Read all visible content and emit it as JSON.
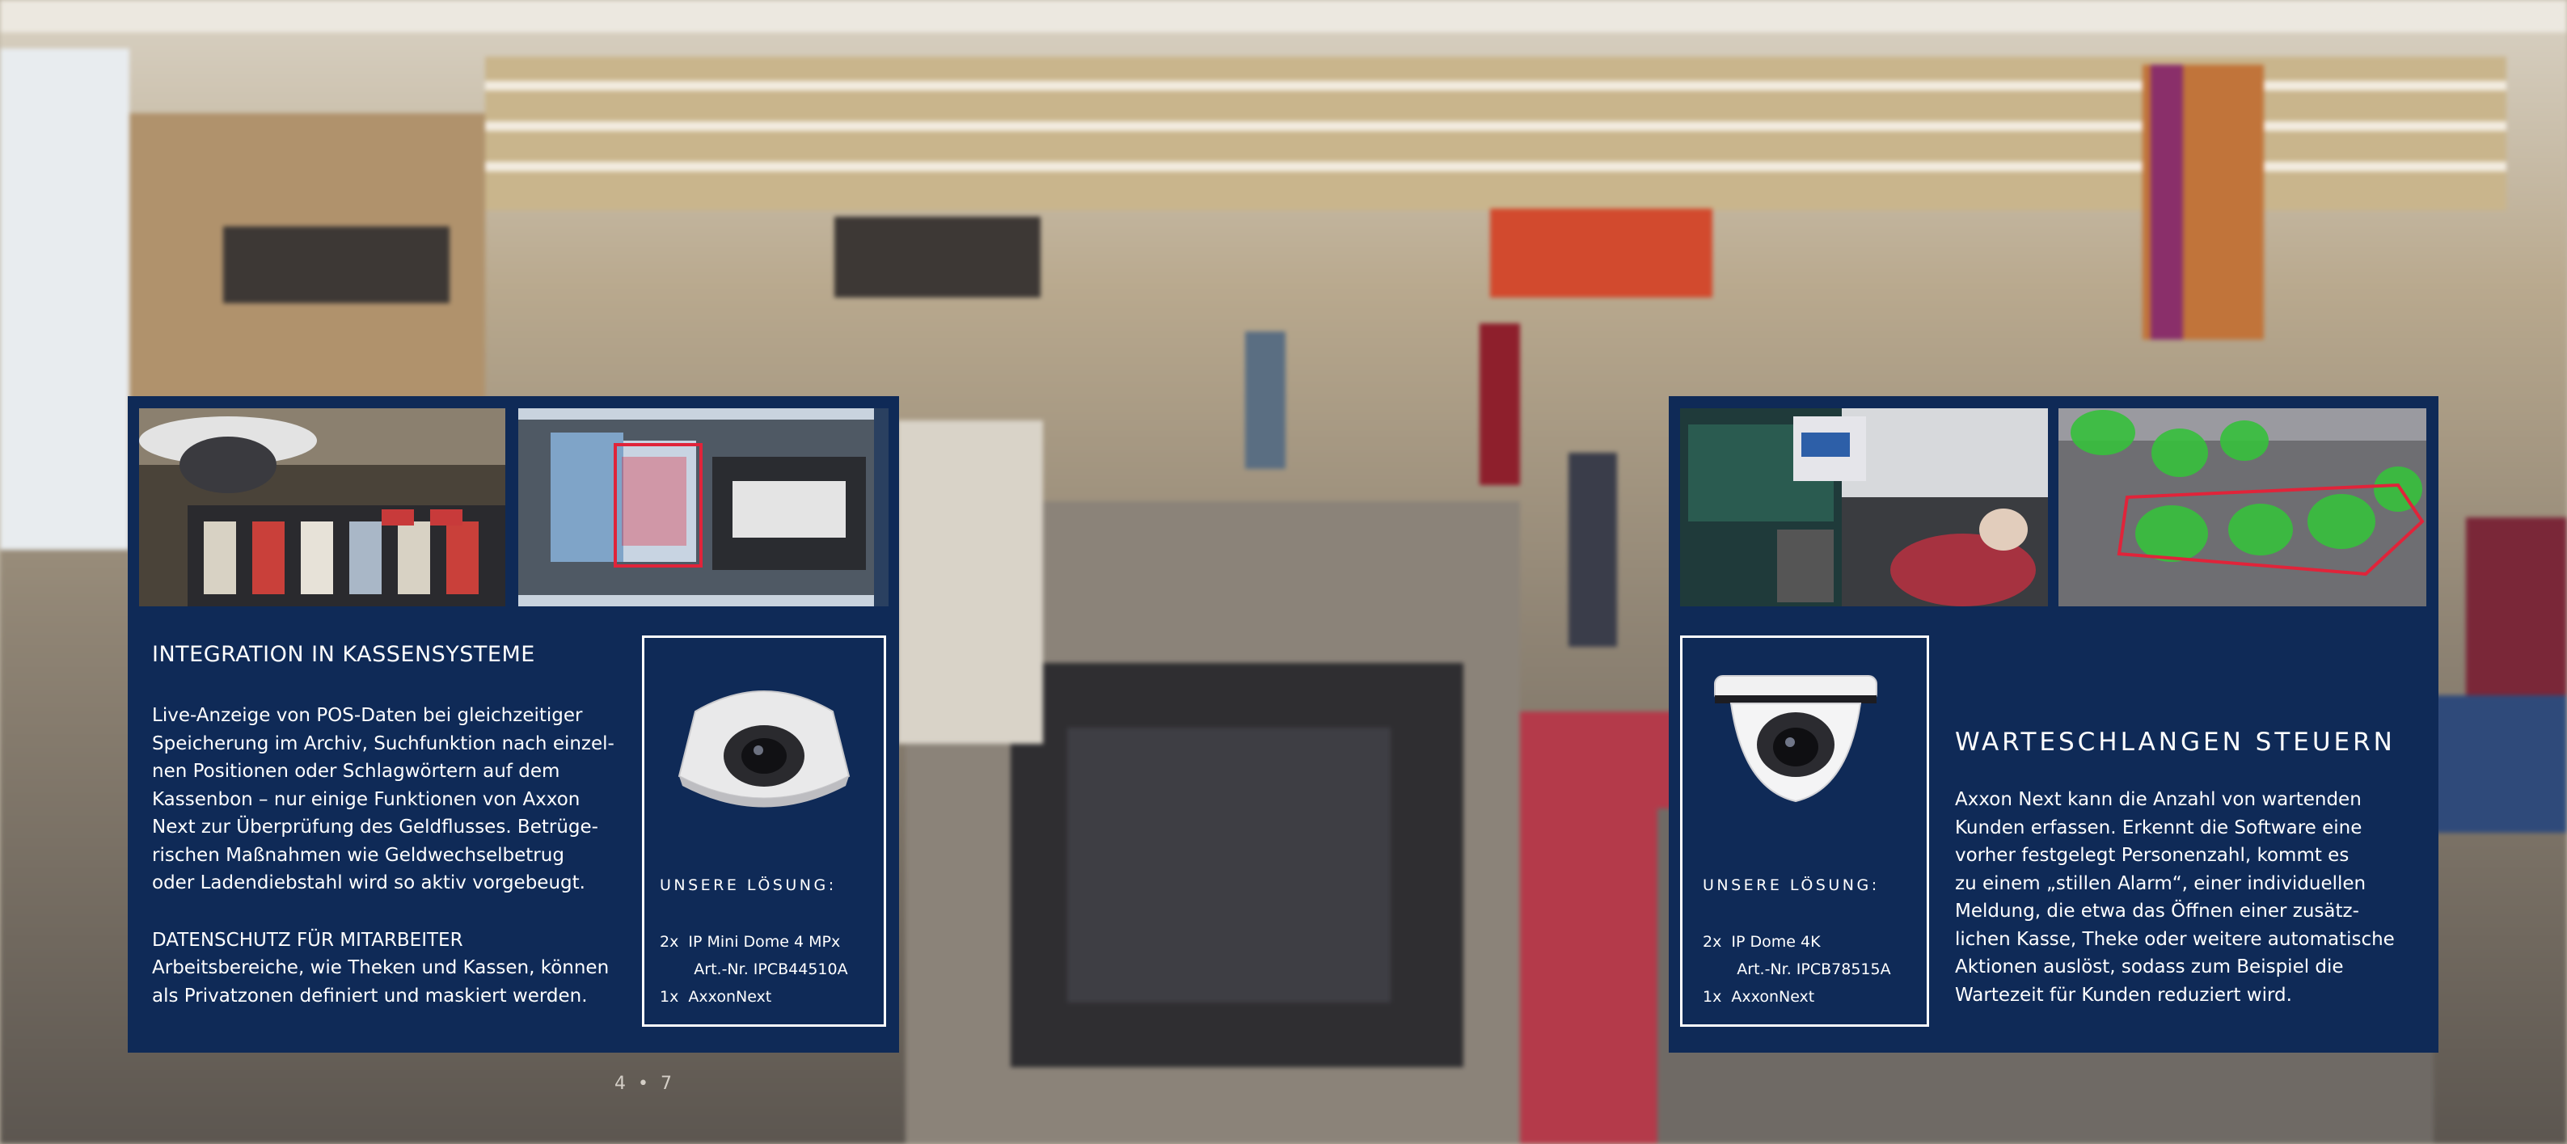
{
  "left_panel": {
    "title": "INTEGRATION IN KASSENSYSTEME",
    "body": "Live-Anzeige von POS-Daten bei gleichzeitiger\nSpeicherung im Archiv, Suchfunktion nach einzel-\nnen Positionen oder Schlagwörtern auf dem\nKassenbon – nur einige Funktionen von Axxon\nNext zur Überprüfung des Geldflusses. Betrüge-\nrischen Maßnahmen wie Geldwechselbetrug\noder Ladendiebstahl wird so aktiv vorgebeugt.",
    "subtitle": "DATENSCHUTZ FÜR MITARBEITER",
    "subbody": "Arbeitsbereiche, wie Theken und Kassen, können\nals Privatzonen definiert und maskiert werden.",
    "solution_label": "UNSERE LÖSUNG:",
    "solution_lines": [
      "2x  IP Mini Dome 4 MPx",
      "       Art.-Nr. IPCB44510A",
      "1x  AxxonNext"
    ],
    "camera_icon": "mini-dome-camera-icon"
  },
  "right_panel": {
    "title": "WARTESCHLANGEN STEUERN",
    "body": "Axxon Next kann die Anzahl von wartenden\nKunden erfassen. Erkennt die Software eine\nvorher festgelegt Personenzahl, kommt es\nzu einem „stillen Alarm“, einer individuellen\nMeldung, die etwa das Öffnen einer zusätz-\nlichen Kasse, Theke oder weitere automatische\nAktionen auslöst, sodass zum Beispiel die\nWartezeit für Kunden reduziert wird.",
    "solution_label": "UNSERE LÖSUNG:",
    "solution_lines": [
      "2x  IP Dome 4K",
      "       Art.-Nr. IPCB78515A",
      "1x  AxxonNext"
    ],
    "camera_icon": "dome-4k-camera-icon"
  },
  "page_numbers": "4 • 7",
  "colors": {
    "panel": "#0f2a57",
    "text": "#ffffff",
    "detection": "#36c03c",
    "alarm": "#e0243a"
  }
}
